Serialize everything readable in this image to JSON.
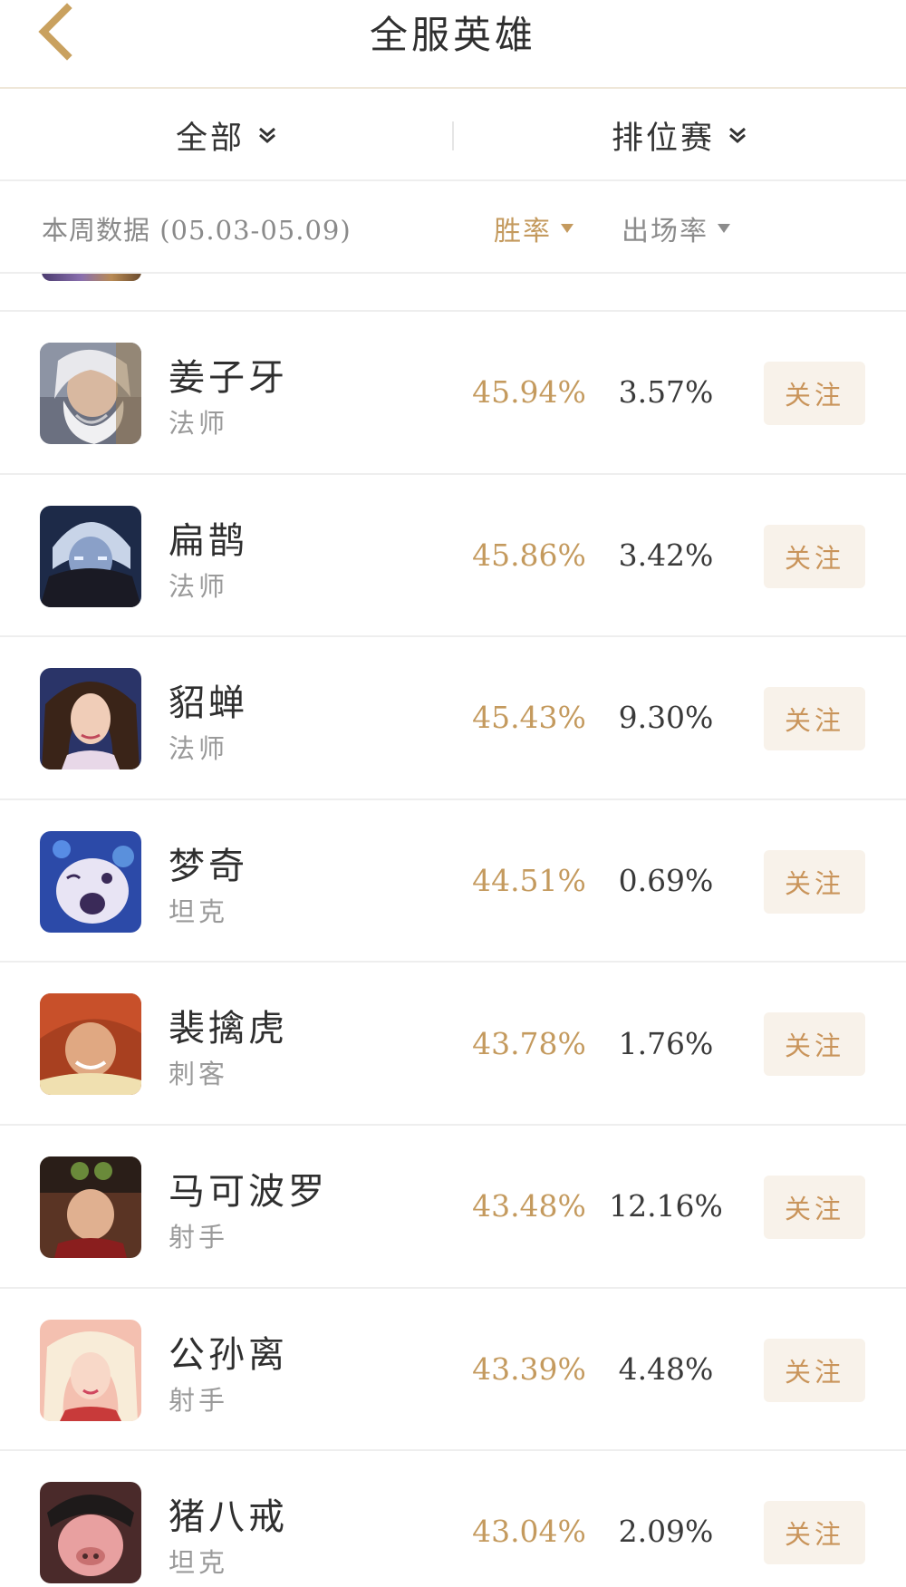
{
  "nav": {
    "title": "全服英雄",
    "back_icon": "chevron-left-icon"
  },
  "filters": {
    "category": {
      "label": "全部",
      "icon": "double-chevron-down-icon"
    },
    "mode": {
      "label": "排位赛",
      "icon": "double-chevron-down-icon"
    }
  },
  "header": {
    "week_label": "本周数据 (05.03-05.09)",
    "sort_win": "胜率",
    "sort_play": "出场率"
  },
  "colors": {
    "accent": "#c49a5e",
    "follow_bg": "#f8f2ea",
    "divider": "#eeeeee"
  },
  "heroes": [
    {
      "name": "姜子牙",
      "role": "法师",
      "win_rate": "45.94%",
      "pick_rate": "3.57%",
      "follow_label": "关注"
    },
    {
      "name": "扁鹊",
      "role": "法师",
      "win_rate": "45.86%",
      "pick_rate": "3.42%",
      "follow_label": "关注"
    },
    {
      "name": "貂蝉",
      "role": "法师",
      "win_rate": "45.43%",
      "pick_rate": "9.30%",
      "follow_label": "关注"
    },
    {
      "name": "梦奇",
      "role": "坦克",
      "win_rate": "44.51%",
      "pick_rate": "0.69%",
      "follow_label": "关注"
    },
    {
      "name": "裴擒虎",
      "role": "刺客",
      "win_rate": "43.78%",
      "pick_rate": "1.76%",
      "follow_label": "关注"
    },
    {
      "name": "马可波罗",
      "role": "射手",
      "win_rate": "43.48%",
      "pick_rate": "12.16%",
      "follow_label": "关注"
    },
    {
      "name": "公孙离",
      "role": "射手",
      "win_rate": "43.39%",
      "pick_rate": "4.48%",
      "follow_label": "关注"
    },
    {
      "name": "猪八戒",
      "role": "坦克",
      "win_rate": "43.04%",
      "pick_rate": "2.09%",
      "follow_label": "关注"
    }
  ]
}
